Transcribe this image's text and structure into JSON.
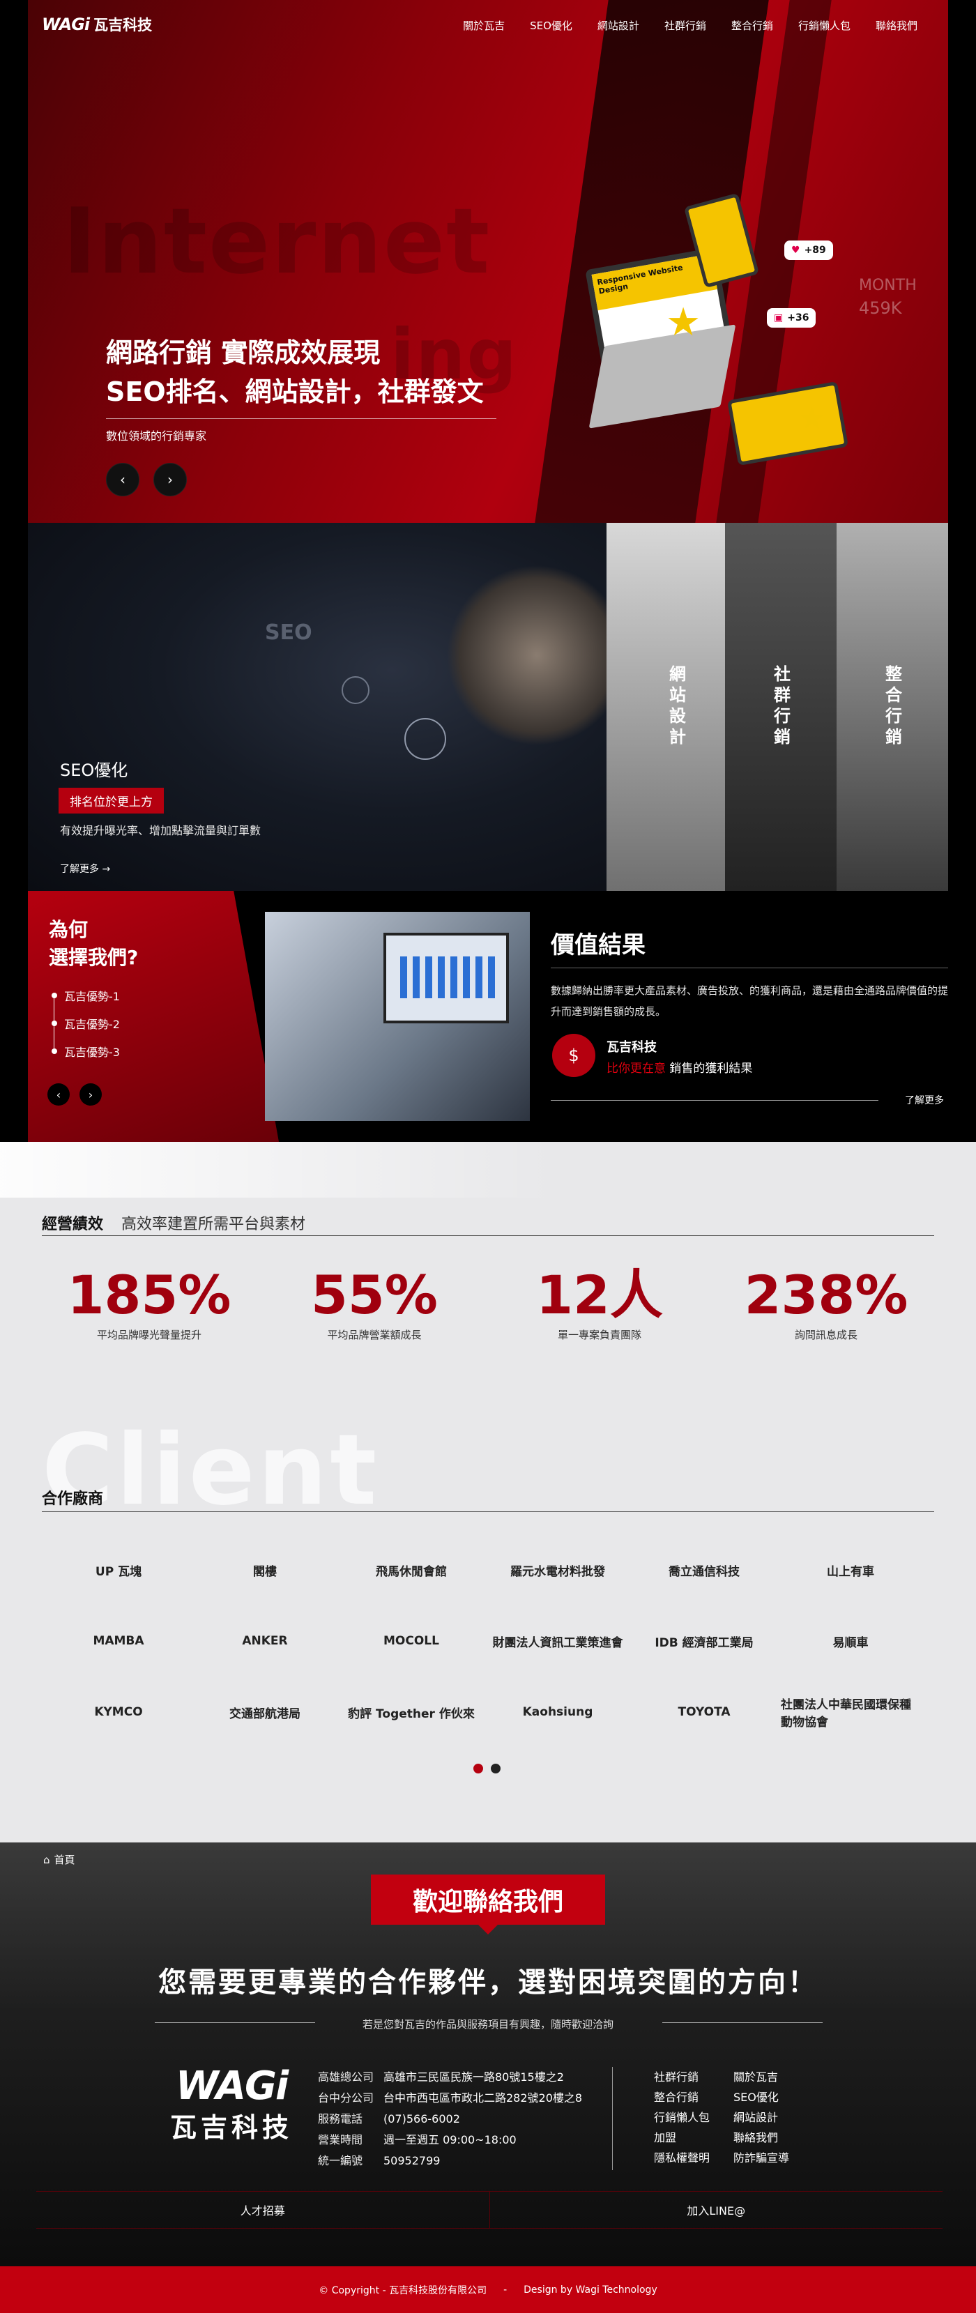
{
  "brand": {
    "logo_mark": "WAGi",
    "logo_text": "瓦吉科技"
  },
  "nav": [
    "關於瓦吉",
    "SEO優化",
    "網站設計",
    "社群行銷",
    "整合行銷",
    "行銷懶人包",
    "聯絡我們"
  ],
  "hero": {
    "bg_words": [
      "Internet",
      "ing"
    ],
    "line1": "網路行銷 實際成效展現",
    "line2": "SEO排名、網站設計，社群發文",
    "sub": "數位領域的行銷專家",
    "prev": "‹",
    "next": "›",
    "badge1": "+89",
    "badge2": "+36",
    "month": "MONTH",
    "month_val": "459K",
    "card_title": "Responsive Website Design"
  },
  "services": {
    "seo": {
      "title": "SEO優化",
      "tag": "排名位於更上方",
      "desc": "有效提升曝光率、增加點擊流量與訂單數",
      "more": "了解更多"
    },
    "cols": [
      "網站設計",
      "社群行銷",
      "整合行銷"
    ]
  },
  "why": {
    "title_l1": "為何",
    "title_l2": "選擇我們?",
    "items": [
      "瓦吉優勢-1",
      "瓦吉優勢-2",
      "瓦吉優勢-3"
    ],
    "value_title": "價值結果",
    "value_desc": "數據歸納出勝率更大產品素材、廣告投放、的獲利商品，還是藉由全通路品牌價值的提升而達到銷售額的成長。",
    "value_name": "瓦吉科技",
    "value_red": "比你更在意",
    "value_tail": "銷售的獲利結果",
    "more": "了解更多"
  },
  "stats": {
    "title": "經營績效",
    "subtitle": "高效率建置所需平台與素材",
    "items": [
      {
        "num": "185%",
        "label": "平均品牌曝光聲量提升"
      },
      {
        "num": "55%",
        "label": "平均品牌營業額成長"
      },
      {
        "num": "12人",
        "label": "單一專案負責團隊"
      },
      {
        "num": "238%",
        "label": "詢問訊息成長"
      }
    ]
  },
  "clients": {
    "bg_word": "Client",
    "title": "合作廠商",
    "rows": [
      [
        "UP 瓦塊",
        "閣樓",
        "飛馬休閒會館",
        "羅元水電材料批發",
        "喬立通信科技",
        "山上有車"
      ],
      [
        "MAMBA",
        "ANKER",
        "MOCOLL",
        "財團法人資訊工業策進會",
        "IDB 經濟部工業局",
        "易順車"
      ],
      [
        "KYMCO",
        "交通部航港局",
        "豹評 Together 作伙來",
        "Kaohsiung",
        "TOYOTA",
        "社團法人中華民國環保種動物協會"
      ]
    ]
  },
  "contact": {
    "breadcrumb": "首頁",
    "ribbon": "歡迎聯絡我們",
    "headline": "您需要更專業的合作夥伴，選對困境突圍的方向！",
    "sub": "若是您對瓦吉的作品與服務項目有興趣，隨時歡迎洽詢",
    "info": [
      {
        "k": "高雄總公司",
        "v": "高雄市三民區民族一路80號15樓之2"
      },
      {
        "k": "台中分公司",
        "v": "台中市西屯區市政北二路282號20樓之8"
      },
      {
        "k": "服務電話",
        "v": "(07)566-6002"
      },
      {
        "k": "營業時間",
        "v": "週一至週五 09:00~18:00"
      },
      {
        "k": "統一編號",
        "v": "50952799"
      }
    ],
    "links_a": [
      "社群行銷",
      "整合行銷",
      "行銷懶人包",
      "加盟",
      "隱私權聲明"
    ],
    "links_b": [
      "關於瓦吉",
      "SEO優化",
      "網站設計",
      "聯絡我們",
      "防詐騙宣導"
    ],
    "bar_left": "人才招募",
    "bar_right": "加入LINE@"
  },
  "copyright": {
    "left": "© Copyright - 瓦吉科技股份有限公司",
    "sep": "-",
    "right": "Design by Wagi Technology"
  },
  "colors": {
    "accent": "#c2000f",
    "dark_red": "#a0000e"
  }
}
